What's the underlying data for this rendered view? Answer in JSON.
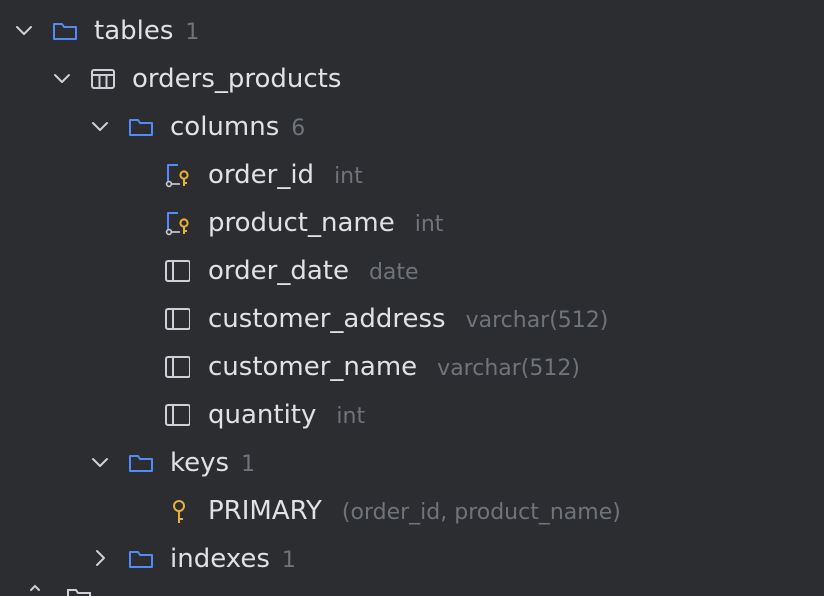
{
  "tree": {
    "tables": {
      "label": "tables",
      "count": "1"
    },
    "table": {
      "label": "orders_products"
    },
    "columns": {
      "label": "columns",
      "count": "6",
      "items": [
        {
          "name": "order_id",
          "type": "int",
          "icon": "primary-key-column-icon"
        },
        {
          "name": "product_name",
          "type": "int",
          "icon": "primary-key-column-icon"
        },
        {
          "name": "order_date",
          "type": "date",
          "icon": "column-icon"
        },
        {
          "name": "customer_address",
          "type": "varchar(512)",
          "icon": "column-icon"
        },
        {
          "name": "customer_name",
          "type": "varchar(512)",
          "icon": "column-icon"
        },
        {
          "name": "quantity",
          "type": "int",
          "icon": "column-icon"
        }
      ]
    },
    "keys": {
      "label": "keys",
      "count": "1",
      "items": [
        {
          "name": "PRIMARY",
          "detail": "(order_id, product_name)",
          "icon": "key-icon"
        }
      ]
    },
    "indexes": {
      "label": "indexes",
      "count": "1"
    }
  },
  "colors": {
    "background": "#2b2d30",
    "text": "#dfe1e5",
    "muted": "#6f737a",
    "folder": "#548af7",
    "key": "#e8b13d",
    "icon_outline": "#ced0d6"
  }
}
